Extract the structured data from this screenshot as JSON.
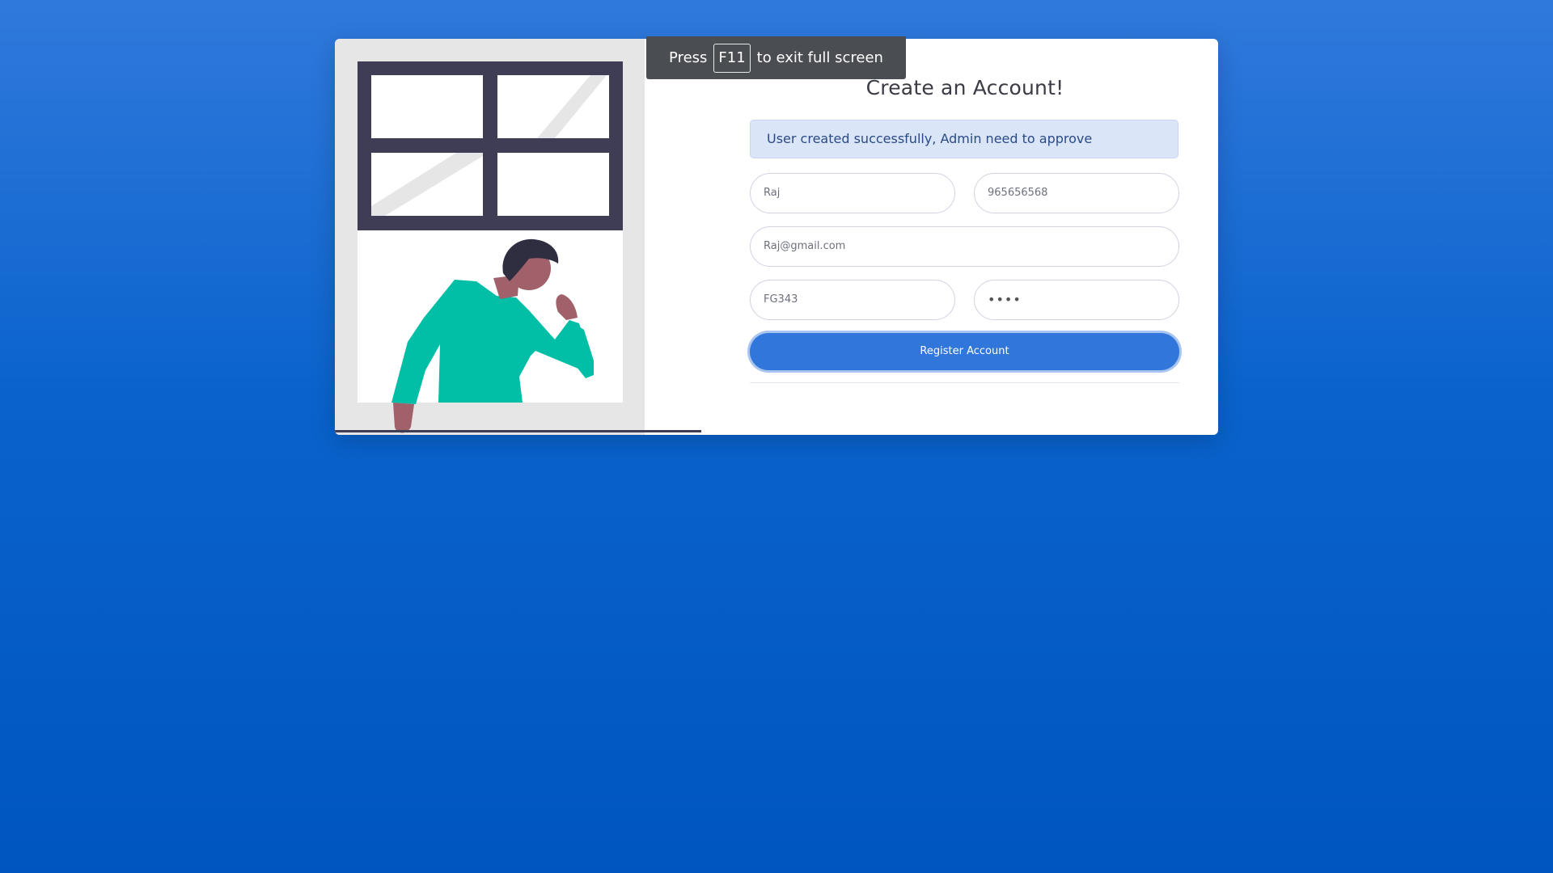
{
  "fullscreen_notice": {
    "press": "Press",
    "key": "F11",
    "suffix": "to exit full screen"
  },
  "form": {
    "title": "Create an Account!",
    "alert": "User created successfully, Admin need to approve",
    "fields": {
      "first_name": "Raj",
      "phone": "965656568",
      "email": "Raj@gmail.com",
      "code": "FG343",
      "password_mask": "••••"
    },
    "submit_label": "Register Account"
  },
  "colors": {
    "background": "#0a63cc",
    "primary": "#3176db",
    "alert_bg": "#dbe5f8",
    "illustration_shirt": "#00bfa6",
    "illustration_frame": "#3f3d56",
    "illustration_skin": "#a0616a"
  },
  "icons": [
    "person-at-window-illustration"
  ]
}
